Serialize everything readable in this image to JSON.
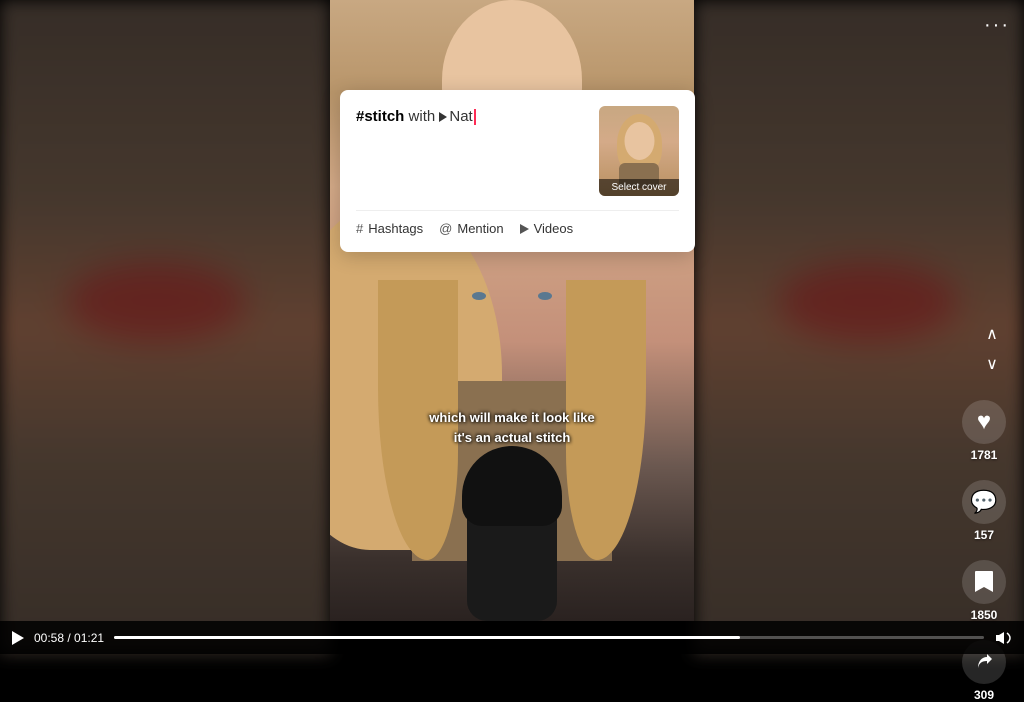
{
  "video": {
    "bg_description": "TikTok video player",
    "caption_line1": "which will make it look like",
    "caption_line2": "it's an actual stitch",
    "time_current": "00:58",
    "time_total": "01:21",
    "progress_percent": 72
  },
  "text_card": {
    "prefix": "#stitch",
    "middle": " with ",
    "username": "Nat",
    "cursor_visible": true
  },
  "cover_button": {
    "label": "Select cover"
  },
  "toolbar": {
    "hashtag_label": "Hashtags",
    "mention_label": "Mention",
    "videos_label": "Videos"
  },
  "actions": {
    "like_count": "1781",
    "comment_count": "157",
    "save_count": "1850",
    "share_count": "309"
  },
  "more_options": {
    "dots": "···"
  },
  "icons": {
    "heart": "♥",
    "comment": "💬",
    "bookmark": "🔖",
    "share": "↗",
    "hashtag": "#",
    "at": "@",
    "video_camera": "▷",
    "play": "▶",
    "chevron_up": "^",
    "chevron_down": "v",
    "volume": "🔊"
  }
}
